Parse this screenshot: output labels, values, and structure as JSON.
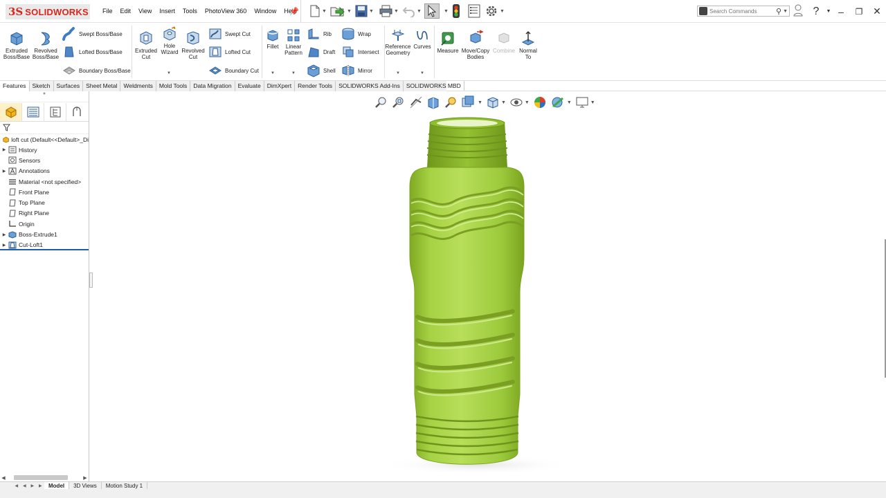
{
  "app": {
    "logo_prefix": "3S",
    "logo_text": "SOLIDWORKS"
  },
  "menu": [
    "File",
    "Edit",
    "View",
    "Insert",
    "Tools",
    "PhotoView 360",
    "Window",
    "Help"
  ],
  "search": {
    "placeholder": "Search Commands"
  },
  "ribbon": {
    "extruded_boss": "Extruded Boss/Base",
    "revolved_boss": "Revolved Boss/Base",
    "swept_boss": "Swept Boss/Base",
    "lofted_boss": "Lofted Boss/Base",
    "boundary_boss": "Boundary Boss/Base",
    "extruded_cut": "Extruded Cut",
    "hole_wizard": "Hole Wizard",
    "revolved_cut": "Revolved Cut",
    "swept_cut": "Swept Cut",
    "lofted_cut": "Lofted Cut",
    "boundary_cut": "Boundary Cut",
    "fillet": "Fillet",
    "linear_pattern": "Linear Pattern",
    "rib": "Rib",
    "draft": "Draft",
    "shell": "Shell",
    "wrap": "Wrap",
    "intersect": "Intersect",
    "mirror": "Mirror",
    "reference_geometry": "Reference Geometry",
    "curves": "Curves",
    "measure": "Measure",
    "move_copy": "Move/Copy Bodies",
    "combine": "Combine",
    "normal_to": "Normal To"
  },
  "tabs": [
    "Features",
    "Sketch",
    "Surfaces",
    "Sheet Metal",
    "Weldments",
    "Mold Tools",
    "Data Migration",
    "Evaluate",
    "DimXpert",
    "Render Tools",
    "SOLIDWORKS Add-Ins",
    "SOLIDWORKS MBD"
  ],
  "tree": {
    "root": "loft cut  (Default<<Default>_Di",
    "items": [
      "History",
      "Sensors",
      "Annotations",
      "Material <not specified>",
      "Front Plane",
      "Top Plane",
      "Right Plane",
      "Origin",
      "Boss-Extrude1",
      "Cut-Loft1"
    ]
  },
  "bottom_tabs": [
    "Model",
    "3D Views",
    "Motion Study 1"
  ],
  "colors": {
    "accent": "#d9261c",
    "bottle": "#9bc93a",
    "selection": "#1d5ea8"
  }
}
